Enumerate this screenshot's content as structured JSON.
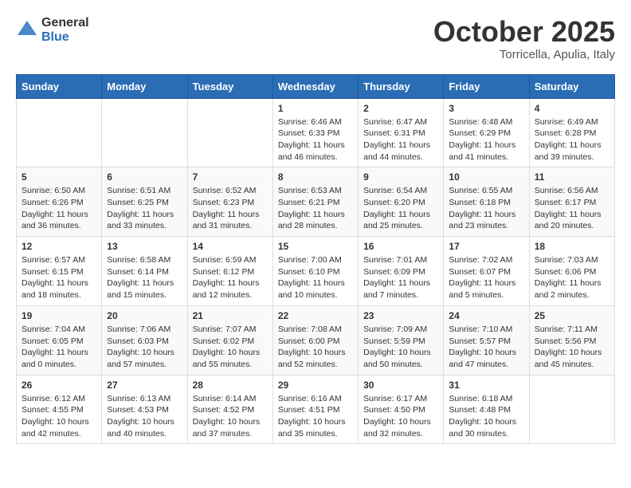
{
  "logo": {
    "general": "General",
    "blue": "Blue"
  },
  "title": "October 2025",
  "location": "Torricella, Apulia, Italy",
  "days_of_week": [
    "Sunday",
    "Monday",
    "Tuesday",
    "Wednesday",
    "Thursday",
    "Friday",
    "Saturday"
  ],
  "weeks": [
    [
      {
        "day": "",
        "info": ""
      },
      {
        "day": "",
        "info": ""
      },
      {
        "day": "",
        "info": ""
      },
      {
        "day": "1",
        "info": "Sunrise: 6:46 AM\nSunset: 6:33 PM\nDaylight: 11 hours and 46 minutes."
      },
      {
        "day": "2",
        "info": "Sunrise: 6:47 AM\nSunset: 6:31 PM\nDaylight: 11 hours and 44 minutes."
      },
      {
        "day": "3",
        "info": "Sunrise: 6:48 AM\nSunset: 6:29 PM\nDaylight: 11 hours and 41 minutes."
      },
      {
        "day": "4",
        "info": "Sunrise: 6:49 AM\nSunset: 6:28 PM\nDaylight: 11 hours and 39 minutes."
      }
    ],
    [
      {
        "day": "5",
        "info": "Sunrise: 6:50 AM\nSunset: 6:26 PM\nDaylight: 11 hours and 36 minutes."
      },
      {
        "day": "6",
        "info": "Sunrise: 6:51 AM\nSunset: 6:25 PM\nDaylight: 11 hours and 33 minutes."
      },
      {
        "day": "7",
        "info": "Sunrise: 6:52 AM\nSunset: 6:23 PM\nDaylight: 11 hours and 31 minutes."
      },
      {
        "day": "8",
        "info": "Sunrise: 6:53 AM\nSunset: 6:21 PM\nDaylight: 11 hours and 28 minutes."
      },
      {
        "day": "9",
        "info": "Sunrise: 6:54 AM\nSunset: 6:20 PM\nDaylight: 11 hours and 25 minutes."
      },
      {
        "day": "10",
        "info": "Sunrise: 6:55 AM\nSunset: 6:18 PM\nDaylight: 11 hours and 23 minutes."
      },
      {
        "day": "11",
        "info": "Sunrise: 6:56 AM\nSunset: 6:17 PM\nDaylight: 11 hours and 20 minutes."
      }
    ],
    [
      {
        "day": "12",
        "info": "Sunrise: 6:57 AM\nSunset: 6:15 PM\nDaylight: 11 hours and 18 minutes."
      },
      {
        "day": "13",
        "info": "Sunrise: 6:58 AM\nSunset: 6:14 PM\nDaylight: 11 hours and 15 minutes."
      },
      {
        "day": "14",
        "info": "Sunrise: 6:59 AM\nSunset: 6:12 PM\nDaylight: 11 hours and 12 minutes."
      },
      {
        "day": "15",
        "info": "Sunrise: 7:00 AM\nSunset: 6:10 PM\nDaylight: 11 hours and 10 minutes."
      },
      {
        "day": "16",
        "info": "Sunrise: 7:01 AM\nSunset: 6:09 PM\nDaylight: 11 hours and 7 minutes."
      },
      {
        "day": "17",
        "info": "Sunrise: 7:02 AM\nSunset: 6:07 PM\nDaylight: 11 hours and 5 minutes."
      },
      {
        "day": "18",
        "info": "Sunrise: 7:03 AM\nSunset: 6:06 PM\nDaylight: 11 hours and 2 minutes."
      }
    ],
    [
      {
        "day": "19",
        "info": "Sunrise: 7:04 AM\nSunset: 6:05 PM\nDaylight: 11 hours and 0 minutes."
      },
      {
        "day": "20",
        "info": "Sunrise: 7:06 AM\nSunset: 6:03 PM\nDaylight: 10 hours and 57 minutes."
      },
      {
        "day": "21",
        "info": "Sunrise: 7:07 AM\nSunset: 6:02 PM\nDaylight: 10 hours and 55 minutes."
      },
      {
        "day": "22",
        "info": "Sunrise: 7:08 AM\nSunset: 6:00 PM\nDaylight: 10 hours and 52 minutes."
      },
      {
        "day": "23",
        "info": "Sunrise: 7:09 AM\nSunset: 5:59 PM\nDaylight: 10 hours and 50 minutes."
      },
      {
        "day": "24",
        "info": "Sunrise: 7:10 AM\nSunset: 5:57 PM\nDaylight: 10 hours and 47 minutes."
      },
      {
        "day": "25",
        "info": "Sunrise: 7:11 AM\nSunset: 5:56 PM\nDaylight: 10 hours and 45 minutes."
      }
    ],
    [
      {
        "day": "26",
        "info": "Sunrise: 6:12 AM\nSunset: 4:55 PM\nDaylight: 10 hours and 42 minutes."
      },
      {
        "day": "27",
        "info": "Sunrise: 6:13 AM\nSunset: 4:53 PM\nDaylight: 10 hours and 40 minutes."
      },
      {
        "day": "28",
        "info": "Sunrise: 6:14 AM\nSunset: 4:52 PM\nDaylight: 10 hours and 37 minutes."
      },
      {
        "day": "29",
        "info": "Sunrise: 6:16 AM\nSunset: 4:51 PM\nDaylight: 10 hours and 35 minutes."
      },
      {
        "day": "30",
        "info": "Sunrise: 6:17 AM\nSunset: 4:50 PM\nDaylight: 10 hours and 32 minutes."
      },
      {
        "day": "31",
        "info": "Sunrise: 6:18 AM\nSunset: 4:48 PM\nDaylight: 10 hours and 30 minutes."
      },
      {
        "day": "",
        "info": ""
      }
    ]
  ]
}
